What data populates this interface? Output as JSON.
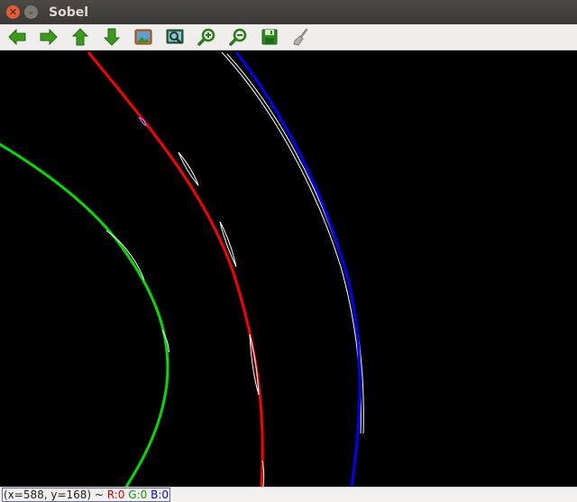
{
  "window": {
    "title": "Sobel"
  },
  "toolbar": {
    "buttons": [
      {
        "name": "pan-left-icon"
      },
      {
        "name": "pan-right-icon"
      },
      {
        "name": "pan-up-icon"
      },
      {
        "name": "pan-down-icon"
      },
      {
        "name": "zoom-fit-icon"
      },
      {
        "name": "zoom-region-icon"
      },
      {
        "name": "zoom-in-icon"
      },
      {
        "name": "zoom-out-icon"
      },
      {
        "name": "save-icon"
      },
      {
        "name": "properties-icon"
      }
    ]
  },
  "status": {
    "coords": "(x=588, y=168) ~ ",
    "r": "R:0",
    "g": "G:0",
    "b": "B:0"
  },
  "colors": {
    "green_curve": "#00dd00",
    "red_curve": "#ff0000",
    "blue_curve": "#0000ff",
    "edges": "#ffffff"
  }
}
